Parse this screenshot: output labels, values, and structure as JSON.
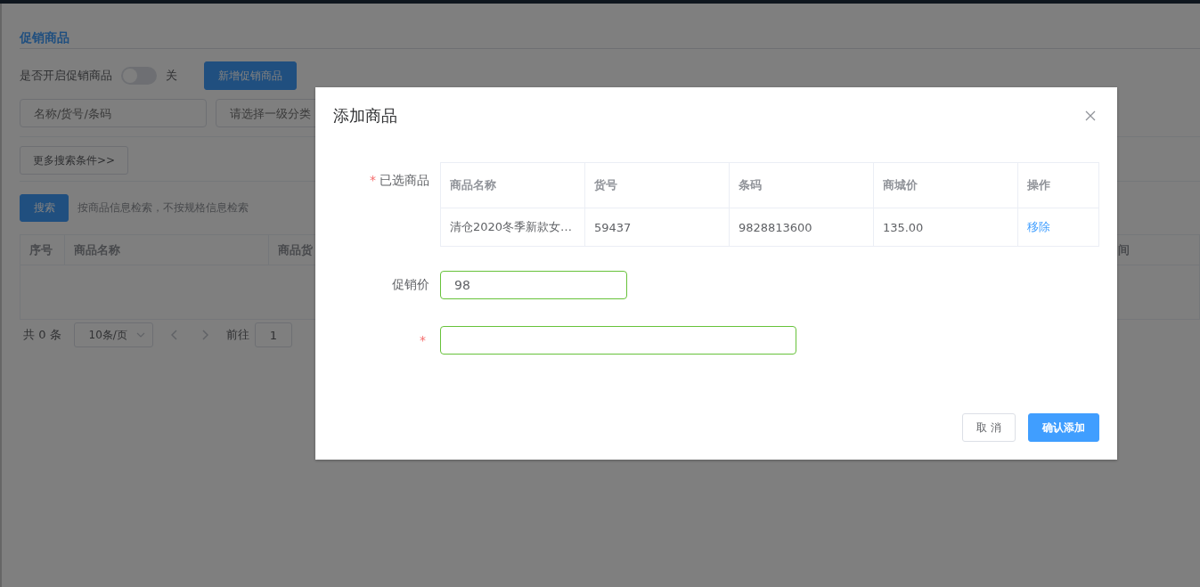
{
  "page": {
    "section_title": "促销商品",
    "toggle_label": "是否开启促销商品",
    "toggle": {
      "on": false,
      "text": "关"
    },
    "add_button": "新增促销商品",
    "search_placeholder": "名称/货号/条码",
    "category_placeholder": "请选择一级分类",
    "more_button": "更多搜索条件>>",
    "search_button": "搜索",
    "search_hint": "按商品信息检索，不按规格信息检索",
    "table": {
      "columns": [
        "序号",
        "商品名称",
        "商品货",
        "间"
      ]
    },
    "pagination": {
      "total": "共 0 条",
      "page_size": "10条/页",
      "goto": "前往",
      "page": "1"
    }
  },
  "dialog": {
    "title": "添加商品",
    "selected_label": {
      "required_mark": "*",
      "label": "已选商品"
    },
    "table": {
      "columns": [
        "商品名称",
        "货号",
        "条码",
        "商城价",
        "操作"
      ],
      "rows": [
        {
          "cells": [
            "清仓2020冬季新款女…",
            "59437",
            "9828813600",
            "135.00"
          ],
          "action": "移除"
        }
      ]
    },
    "price_label": "促销价",
    "price_value": "98",
    "third_field": {
      "required_mark": "*"
    },
    "buttons": [
      {
        "label": "取 消",
        "kind": "default"
      },
      {
        "label": "确认添加",
        "kind": "primary"
      }
    ]
  }
}
